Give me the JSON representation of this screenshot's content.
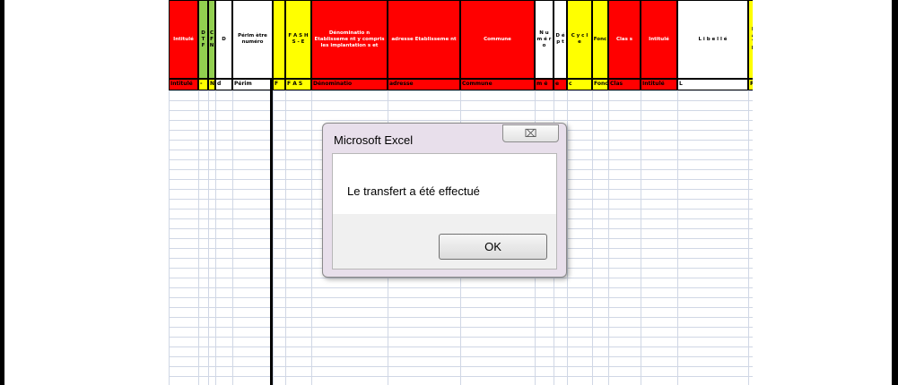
{
  "dialog": {
    "title": "Microsoft Excel",
    "close_glyph": "⌧",
    "message": "Le transfert a été effectué",
    "ok_label": "OK"
  },
  "sheet": {
    "header_row": [
      {
        "text": "Intitulé",
        "color": "#ff0000"
      },
      {
        "text": "D T F",
        "color": "#92d050"
      },
      {
        "text": "C F N",
        "color": "#92d050"
      },
      {
        "text": "D",
        "color": "#ffffff"
      },
      {
        "text": "Périm ètre numéro",
        "color": "#ffffff"
      },
      {
        "text": "",
        "color": "#ffff00"
      },
      {
        "text": "F A S H S - E",
        "color": "#ffff00"
      },
      {
        "text": "Dénominatio n Etablisseme nt y compris les implantation s et",
        "color": "#ff0000"
      },
      {
        "text": "adresse Etablisseme nt",
        "color": "#ff0000"
      },
      {
        "text": "Commune",
        "color": "#ff0000"
      },
      {
        "text": "N u m é r o",
        "color": "#ffffff"
      },
      {
        "text": "D é p t",
        "color": "#ffffff"
      },
      {
        "text": "C y c l e",
        "color": "#ffff00"
      },
      {
        "text": "Fonc",
        "color": "#ffff00"
      },
      {
        "text": "Clas s",
        "color": "#ff0000"
      },
      {
        "text": "Intitulé",
        "color": "#ff0000"
      },
      {
        "text": "L i b e l l é",
        "color": "#ffffff"
      },
      {
        "text": "R A T N",
        "color": "#ffff00"
      }
    ],
    "sub_row": [
      {
        "text": "Intitulé",
        "color": "#ff0000"
      },
      {
        "text": "-",
        "color": "#ffff00"
      },
      {
        "text": "N",
        "color": "#ffff00"
      },
      {
        "text": "d",
        "color": "#ffffff"
      },
      {
        "text": "Périm",
        "color": "#ffffff"
      },
      {
        "text": "F",
        "color": "#ffff00"
      },
      {
        "text": "F A S",
        "color": "#ffff00"
      },
      {
        "text": "Dénominatio",
        "color": "#ff0000"
      },
      {
        "text": "adresse",
        "color": "#ff0000"
      },
      {
        "text": "Commune",
        "color": "#ff0000"
      },
      {
        "text": "m é",
        "color": "#ff0000"
      },
      {
        "text": "e",
        "color": "#ff0000"
      },
      {
        "text": "c",
        "color": "#ffff00"
      },
      {
        "text": "Fonc",
        "color": "#ffff00"
      },
      {
        "text": "Clas",
        "color": "#ff0000"
      },
      {
        "text": "Intitulé",
        "color": "#ff0000"
      },
      {
        "text": "L",
        "color": "#ffffff"
      },
      {
        "text": "R",
        "color": "#ffff00"
      }
    ]
  }
}
